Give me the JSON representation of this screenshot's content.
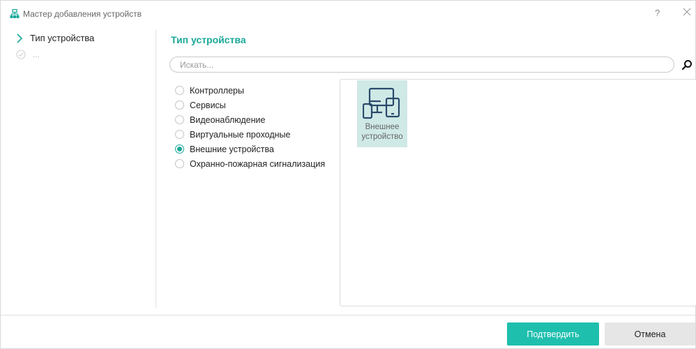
{
  "window": {
    "title": "Мастер добавления устройств",
    "help_label": "?",
    "accent_color": "#1aa89a"
  },
  "steps": [
    {
      "label": "Тип устройства",
      "state": "current",
      "icon": "chevron-right-icon"
    },
    {
      "label": "...",
      "state": "pending",
      "icon": "check-circle-icon"
    }
  ],
  "content": {
    "title": "Тип устройства",
    "search": {
      "placeholder": "Искать...",
      "value": ""
    }
  },
  "categories": [
    {
      "label": "Контроллеры",
      "checked": false
    },
    {
      "label": "Сервисы",
      "checked": false
    },
    {
      "label": "Видеонаблюдение",
      "checked": false
    },
    {
      "label": "Виртуальные проходные",
      "checked": false
    },
    {
      "label": "Внешние устройства",
      "checked": true
    },
    {
      "label": "Охранно-пожарная сигнализация",
      "checked": false
    }
  ],
  "tiles": [
    {
      "label": "Внешнее устройство",
      "icon": "devices-icon",
      "selected": true
    }
  ],
  "footer": {
    "confirm_label": "Подтвердить",
    "cancel_label": "Отмена"
  }
}
